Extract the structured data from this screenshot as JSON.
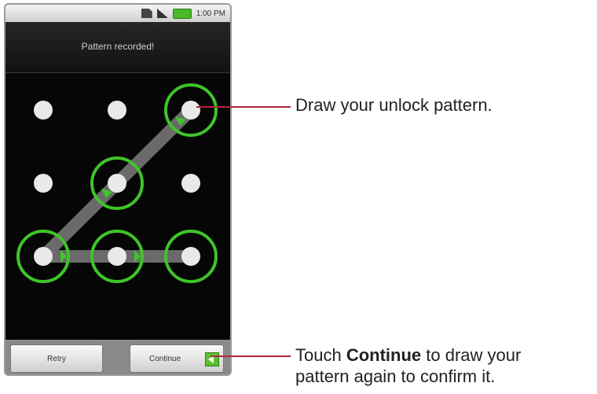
{
  "status_bar": {
    "time": "1:00 PM"
  },
  "screen": {
    "header": "Pattern recorded!"
  },
  "pattern_grid": {
    "selected_dots": [
      3,
      5,
      7,
      8,
      9
    ],
    "colors": {
      "path": "#6a6a6a",
      "ring": "#3fc42a",
      "dot": "#e9e9e9"
    }
  },
  "buttons": {
    "retry": "Retry",
    "continue": "Continue"
  },
  "callouts": {
    "draw": "Draw your unlock pattern.",
    "touch_prefix": "Touch ",
    "touch_bold": "Continue",
    "touch_suffix": " to draw your",
    "touch_line2": "pattern again to confirm it."
  }
}
